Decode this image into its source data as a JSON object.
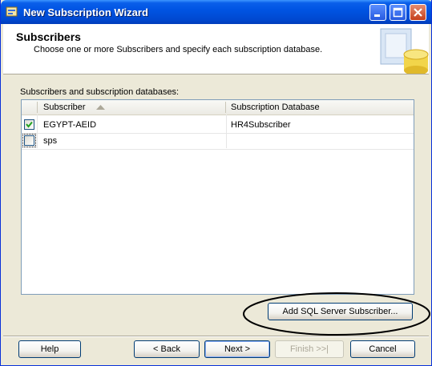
{
  "window": {
    "title": "New Subscription Wizard"
  },
  "header": {
    "title": "Subscribers",
    "description": "Choose one or more Subscribers and specify each subscription database."
  },
  "list": {
    "label": "Subscribers and subscription databases:",
    "columns": [
      "Subscriber",
      "Subscription Database"
    ],
    "rows": [
      {
        "checked": true,
        "subscriber": "EGYPT-AEID",
        "database": "HR4Subscriber"
      },
      {
        "checked": false,
        "subscriber": "sps",
        "database": ""
      }
    ]
  },
  "actions": {
    "add_subscriber": "Add SQL Server Subscriber..."
  },
  "footer": {
    "help": "Help",
    "back": "< Back",
    "next": "Next >",
    "finish": "Finish >>|",
    "cancel": "Cancel"
  },
  "colors": {
    "title_bar": "#0054e3",
    "dialog_bg": "#ece9d8",
    "check": "#21a121"
  }
}
